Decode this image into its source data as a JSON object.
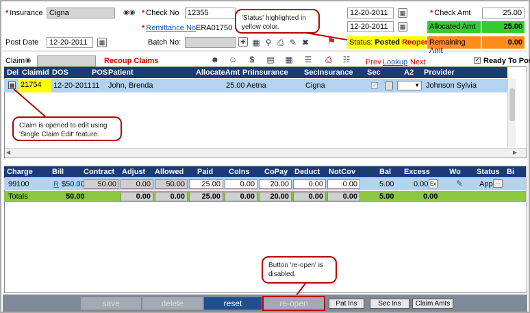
{
  "header": {
    "insurance_label": "Insurance",
    "insurance_value": "Cigna",
    "checkno_label": "Check No",
    "checkno_value": "12355",
    "remittance_label": "Remittance No",
    "remittance_value": "ERA01750",
    "date1": "12-20-2011",
    "date2": "12-20-2011",
    "checkamt_label": "Check Amt",
    "checkamt_value": "25.00",
    "allocated_label": "Allocated Amt",
    "allocated_value": "25.00",
    "remaining_label": "Remaining Amt",
    "remaining_value": "0.00",
    "postdate_label": "Post Date",
    "postdate_value": "12-20-2011",
    "batchno_label": "Batch No:",
    "status_label": "Status:",
    "status_value": "Posted",
    "reopen_label": "Reopen"
  },
  "claimbar": {
    "claim_label": "Claim",
    "recoup_label": "Recoup Claims",
    "prev": "Prev",
    "lookup": "Lookup",
    "next": "Next",
    "ready_label": "Ready To Post"
  },
  "claims": {
    "columns": [
      "Del",
      "ClaimId",
      "DOS",
      "POS",
      "Patient",
      "AllocateAmt",
      "PriInsurance",
      "SecInsurance",
      "Sec",
      "A2",
      "Provider"
    ],
    "row": {
      "claimid": "21754",
      "dos": "12-20-2011",
      "pos": "11",
      "patient": "John, Brenda",
      "allocate": "25.00",
      "pri": "Aetna",
      "sec_ins": "Cigna",
      "provider": "Johnson Sylvia"
    }
  },
  "charges": {
    "columns": [
      "Charge",
      "Bill",
      "Contract",
      "Adjust",
      "Allowed",
      "Paid",
      "CoIns",
      "CoPay",
      "Deduct",
      "NotCov",
      "Bal",
      "Excess",
      "Wo",
      "Status",
      "Bi"
    ],
    "row": {
      "charge": "99100",
      "r": "R",
      "bill": "$50.00",
      "contract": "50.00",
      "adjust": "0.00",
      "allowed": "50.00",
      "paid": "25.00",
      "coins": "0.00",
      "copay": "20.00",
      "deduct": "0.00",
      "notcov": "0.00",
      "bal": "5.00",
      "excess": "0.00",
      "status": "App"
    },
    "totals": {
      "label": "Totals",
      "bill": "50.00",
      "adjust": "0.00",
      "allowed": "0.00",
      "paid": "25.00",
      "coins": "0.00",
      "copay": "20.00",
      "deduct": "0.00",
      "notcov": "0.00",
      "bal": "5.00",
      "excess": "0.00"
    }
  },
  "callouts": {
    "status": "'Status' highlighted in yellow color.",
    "claim": "Claim is opened to edit using 'Single Claim Edit' feature.",
    "reopen": "Button 're-open' is disabled."
  },
  "buttons": {
    "save": "save",
    "delete": "delete",
    "reset": "reset",
    "reopen": "re-open",
    "patins": "Pat Ins",
    "secins": "Sec Ins",
    "claimamts": "Claim Amts"
  },
  "colors": {
    "header_navy": "#1a3a78",
    "row_blue": "#b3d3f2",
    "allocated_green": "#33cc33",
    "remaining_orange": "#ff8c1a",
    "status_yellow": "#ffff00",
    "totals_green": "#8dc63f"
  }
}
